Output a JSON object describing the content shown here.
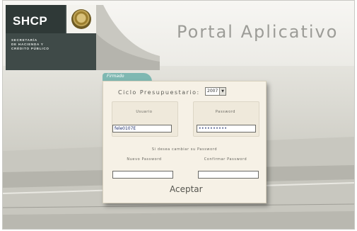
{
  "header": {
    "logo_text": "SHCP",
    "department_text": "SECRETARÍA\nDE HACIENDA Y\nCRÉDITO PÚBLICO",
    "title": "Portal Aplicativo"
  },
  "form": {
    "tab_label": "Firmado",
    "ciclo_label": "Ciclo Presupuestario:",
    "ciclo_value": "2007",
    "usuario_label": "Usuario",
    "usuario_value": "fele0107E",
    "password_label": "Password",
    "password_value": "••••••••••",
    "cambiar_label": "Si desea cambiar su Password",
    "nuevo_label": "Nuevo Password",
    "confirmar_label": "Confirmar Password",
    "nuevo_value": "",
    "confirmar_value": "",
    "submit_label": "Aceptar"
  },
  "colors": {
    "brand_dark": "#3f4a48",
    "tab_teal": "#7fb8b2",
    "panel_bg": "#f6f1e6",
    "title_gray": "#9c9c97"
  },
  "icons": {
    "seal": "mexican-coat-of-arms-icon",
    "dropdown": "chevron-down-icon"
  }
}
